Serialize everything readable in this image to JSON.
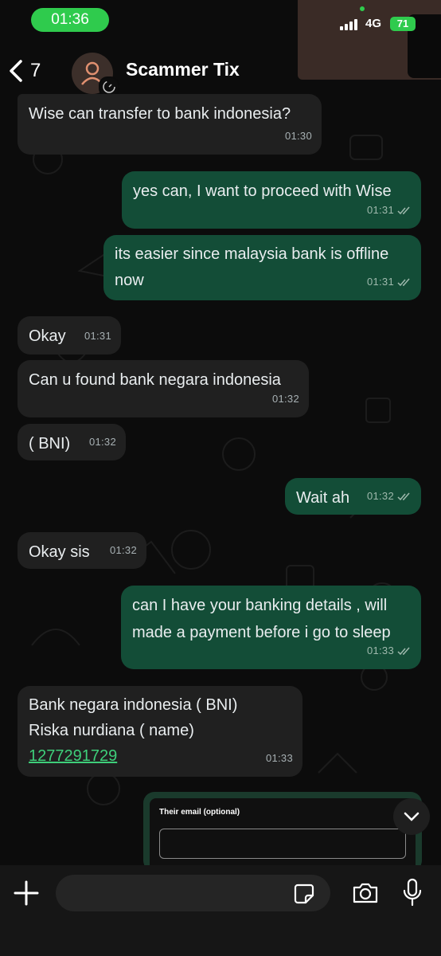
{
  "status_bar": {
    "time": "01:36",
    "network": "4G",
    "battery": "71"
  },
  "header": {
    "back_count": "7",
    "contact_name": "Scammer Tix"
  },
  "messages": [
    {
      "direction": "in",
      "text": "Wise can transfer to bank indonesia?",
      "time": "01:30"
    },
    {
      "direction": "out",
      "text": "yes can, I want to proceed with Wise",
      "time": "01:31"
    },
    {
      "direction": "out",
      "text": "its easier since malaysia bank is offline\nnow",
      "time": "01:31"
    },
    {
      "direction": "in",
      "text": "Okay",
      "time": "01:31"
    },
    {
      "direction": "in",
      "text": "Can u found bank negara indonesia",
      "time": "01:32"
    },
    {
      "direction": "in",
      "text": "( BNI)",
      "time": "01:32"
    },
    {
      "direction": "out",
      "text": "Wait ah",
      "time": "01:32"
    },
    {
      "direction": "in",
      "text": "Okay sis",
      "time": "01:32"
    },
    {
      "direction": "out",
      "text": "can I have your banking details , will\nmade a payment before i go to sleep",
      "time": "01:33"
    },
    {
      "direction": "in",
      "text": "Bank negara indonesia ( BNI)\nRiska nurdiana ( name)",
      "link": "1277291729",
      "time": "01:33"
    }
  ],
  "form_preview": {
    "label": "Their email (optional)"
  },
  "colors": {
    "outgoing": "#134d37",
    "incoming": "#202020",
    "accent": "#2fcb4d",
    "link": "#3ecf7a"
  }
}
